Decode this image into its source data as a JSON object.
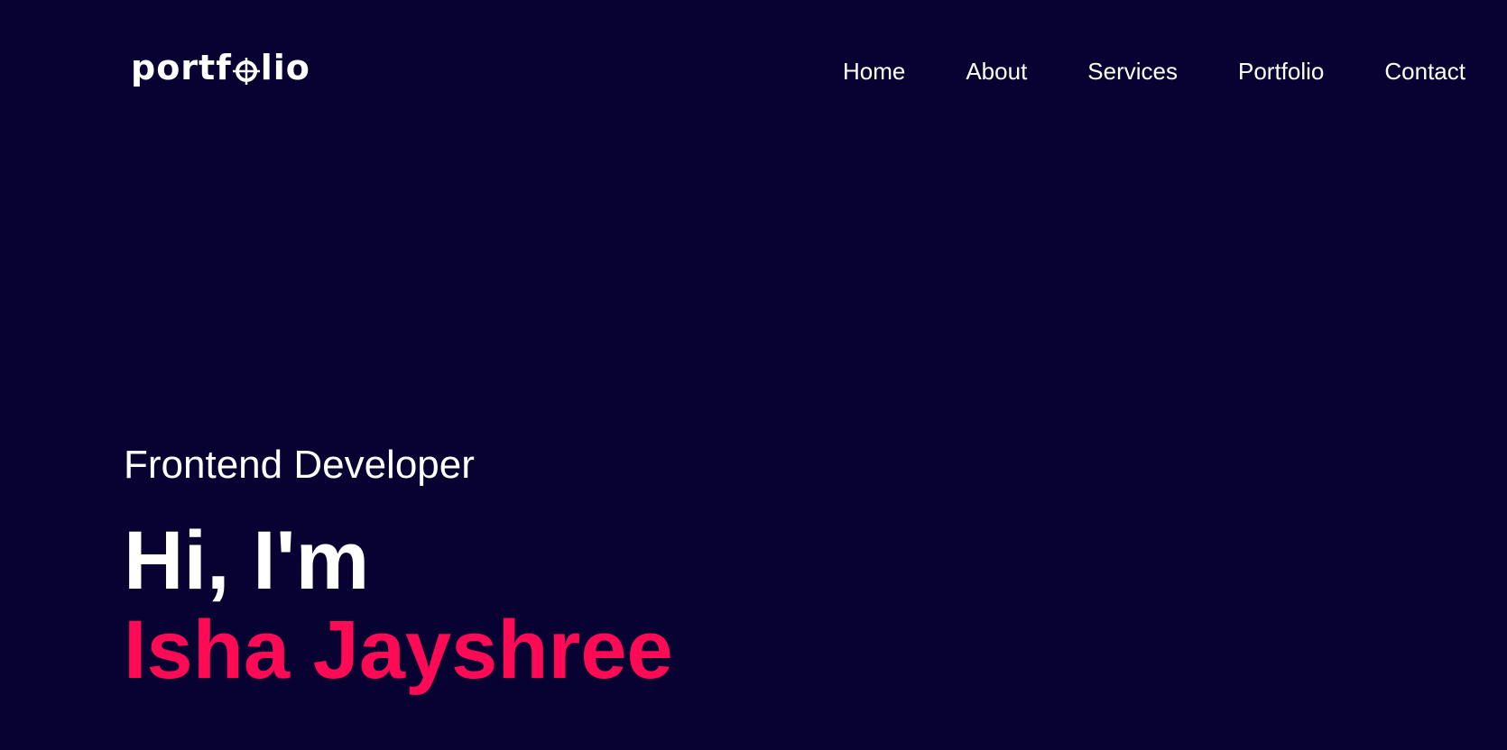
{
  "header": {
    "logo_prefix": "portf",
    "logo_suffix": "lio",
    "logo_mark_icon": "crosshair-o-icon"
  },
  "nav": {
    "items": [
      {
        "label": "Home"
      },
      {
        "label": "About"
      },
      {
        "label": "Services"
      },
      {
        "label": "Portfolio"
      },
      {
        "label": "Contact"
      }
    ]
  },
  "hero": {
    "role": "Frontend Developer",
    "greeting": "Hi, I'm",
    "name": "Isha Jayshree"
  },
  "colors": {
    "background": "#070231",
    "text": "#ffffff",
    "accent": "#ff0a55"
  }
}
